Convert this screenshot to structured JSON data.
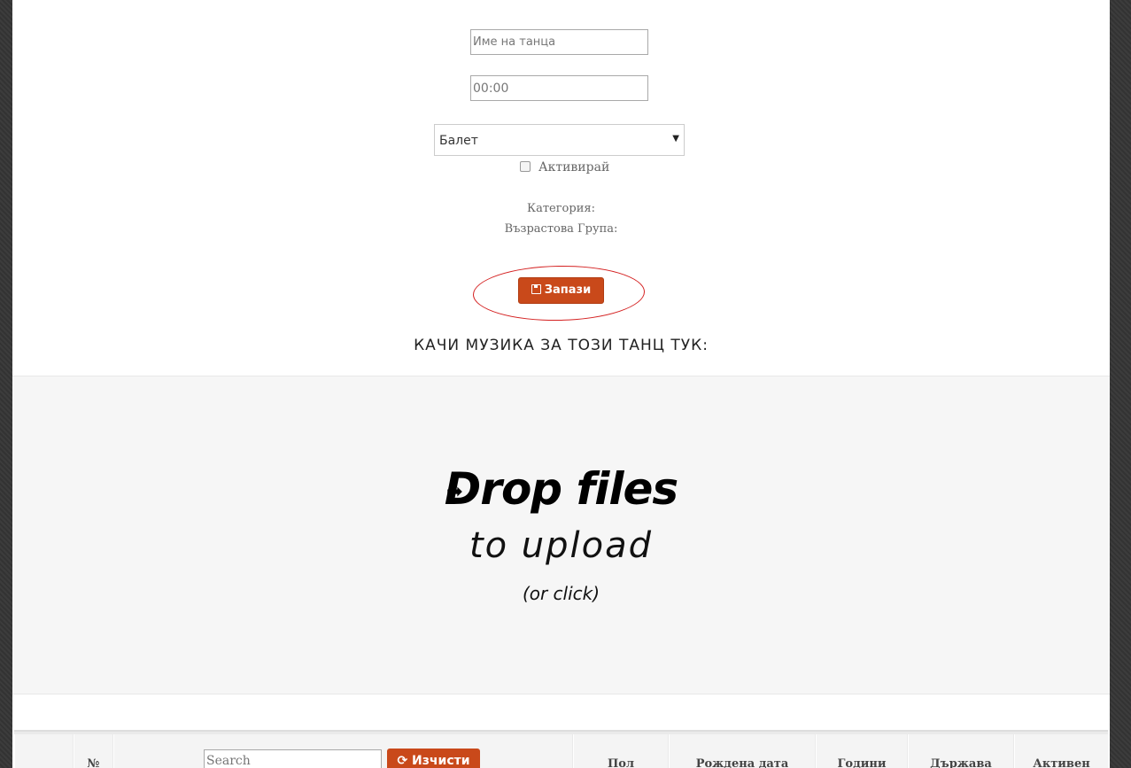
{
  "form": {
    "name_placeholder": "Име на танца",
    "time_placeholder": "00:00",
    "style_select": {
      "selected": "Балет"
    },
    "activate_label": "Активирай",
    "category_label": "Категория:",
    "age_group_label": "Възрастова Група:",
    "save_label": "Запази"
  },
  "upload": {
    "heading": "КАЧИ МУЗИКА ЗА ТОЗИ ТАНЦ ТУК:",
    "arrow": "➡",
    "drop_title": "Drop files",
    "drop_sub": "to upload",
    "drop_hint": "(or click)"
  },
  "table": {
    "columns": [
      "№",
      "Пол",
      "Рождена дата",
      "Години",
      "Държава",
      "Активен"
    ],
    "search_placeholder": "Search",
    "clear_label": "Изчисти"
  },
  "colors": {
    "accent": "#c9491a",
    "annotation": "#d42020"
  }
}
